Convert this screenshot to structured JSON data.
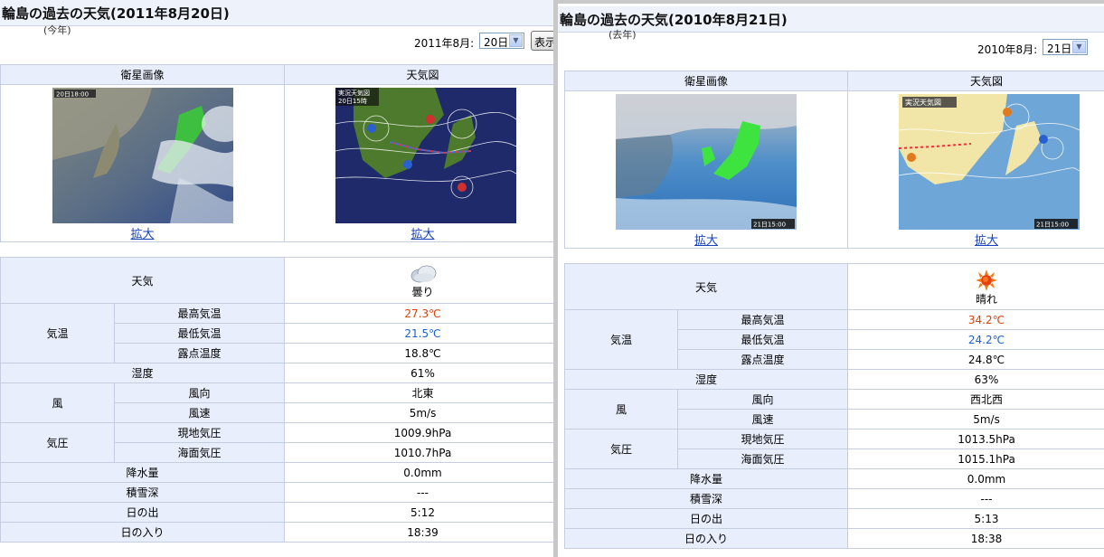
{
  "left": {
    "title": "輪島の過去の天気(2011年8月20日)",
    "year_note": "(今年)",
    "date_label": "2011年8月:",
    "day_value": "20日",
    "show_button": "表示",
    "satellite_header": "衛星画像",
    "weather_map_header": "天気図",
    "satellite_stamp": "20日18:00",
    "weather_map_stamp": "20日15時",
    "weather_map_title": "実況天気図",
    "zoom_label": "拡大",
    "weather_label": "天気",
    "weather_value": "曇り",
    "temp_label": "気温",
    "max_temp_label": "最高気温",
    "max_temp": "27.3℃",
    "min_temp_label": "最低気温",
    "min_temp": "21.5℃",
    "dew_point_label": "露点温度",
    "dew_point": "18.8℃",
    "humidity_label": "湿度",
    "humidity": "61%",
    "wind_label": "風",
    "wind_dir_label": "風向",
    "wind_dir": "北東",
    "wind_speed_label": "風速",
    "wind_speed": "5m/s",
    "pressure_label": "気圧",
    "station_pressure_label": "現地気圧",
    "station_pressure": "1009.9hPa",
    "sea_pressure_label": "海面気圧",
    "sea_pressure": "1010.7hPa",
    "precip_label": "降水量",
    "precip": "0.0mm",
    "snow_label": "積雪深",
    "snow": "---",
    "sunrise_label": "日の出",
    "sunrise": "5:12",
    "sunset_label": "日の入り",
    "sunset": "18:39"
  },
  "right": {
    "title": "輪島の過去の天気(2010年8月21日)",
    "year_note": "(去年)",
    "date_label": "2010年8月:",
    "day_value": "21日",
    "satellite_header": "衛星画像",
    "weather_map_header": "天気図",
    "satellite_stamp": "21日15:00",
    "weather_map_stamp": "21日15:00",
    "weather_map_title": "実況天気図",
    "zoom_label": "拡大",
    "weather_label": "天気",
    "weather_value": "晴れ",
    "temp_label": "気温",
    "max_temp_label": "最高気温",
    "max_temp": "34.2℃",
    "min_temp_label": "最低気温",
    "min_temp": "24.2℃",
    "dew_point_label": "露点温度",
    "dew_point": "24.8℃",
    "humidity_label": "湿度",
    "humidity": "63%",
    "wind_label": "風",
    "wind_dir_label": "風向",
    "wind_dir": "西北西",
    "wind_speed_label": "風速",
    "wind_speed": "5m/s",
    "pressure_label": "気圧",
    "station_pressure_label": "現地気圧",
    "station_pressure": "1013.5hPa",
    "sea_pressure_label": "海面気圧",
    "sea_pressure": "1015.1hPa",
    "precip_label": "降水量",
    "precip": "0.0mm",
    "snow_label": "積雪深",
    "snow": "---",
    "sunrise_label": "日の出",
    "sunrise": "5:13",
    "sunset_label": "日の入り",
    "sunset": "18:38"
  },
  "colors": {
    "max_temp": "#d8400c",
    "min_temp": "#1c5fd0",
    "header_bg": "#e8eefb"
  },
  "icons": {
    "left_weather": "cloudy-icon",
    "right_weather": "sunny-icon"
  }
}
